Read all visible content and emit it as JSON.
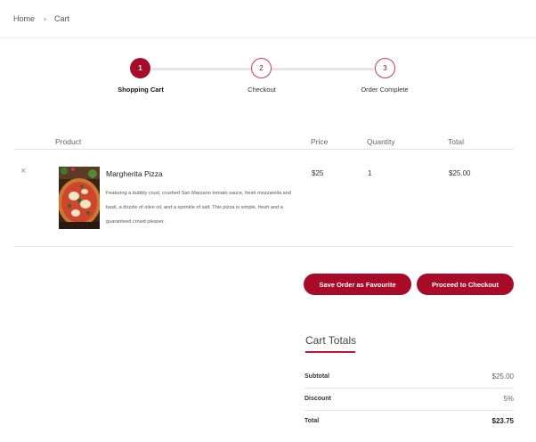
{
  "breadcrumb": {
    "home": "Home",
    "separator": "›",
    "current": "Cart"
  },
  "stepper": {
    "steps": [
      {
        "number": "1",
        "label": "Shopping Cart",
        "active": true
      },
      {
        "number": "2",
        "label": "Checkout",
        "active": false
      },
      {
        "number": "3",
        "label": "Order Complete",
        "active": false
      }
    ]
  },
  "cart": {
    "headers": {
      "product": "Product",
      "price": "Price",
      "quantity": "Quantity",
      "total": "Total"
    },
    "items": [
      {
        "remove_icon": "×",
        "name": "Margherita Pizza",
        "description": "Featuring a bubbly crust, crushed San Marzano tomato sauce, fresh mozzarella and basil, a drizzle of olive oil, and a sprinkle of salt. This pizza is simple, fresh and a guaranteed crowd pleaser.",
        "price": "$25",
        "quantity": "1",
        "total": "$25.00"
      }
    ]
  },
  "actions": {
    "save_favourite": "Save Order as Favourite",
    "checkout": "Proceed to Checkout"
  },
  "totals": {
    "title": "Cart Totals",
    "subtotal_label": "Subtotal",
    "subtotal_value": "$25.00",
    "discount_label": "Discount",
    "discount_value": "5%",
    "total_label": "Total",
    "total_value": "$23.75"
  },
  "colors": {
    "accent": "#a80a27",
    "accent_light": "#d93a4f",
    "divider": "#e3e3e3"
  }
}
